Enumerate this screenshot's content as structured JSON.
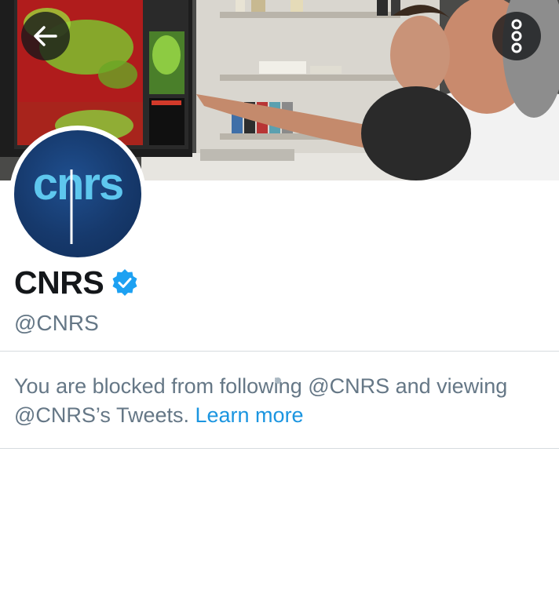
{
  "profile": {
    "name": "CNRS",
    "handle": "@CNRS",
    "verified": true,
    "avatar_logo_text": "cnrs"
  },
  "blocked_notice": {
    "text": "You are blocked from following @CNRS and viewing @CNRS’s Tweets.",
    "link_label": "Learn more"
  },
  "icons": {
    "back": "back-arrow-icon",
    "more": "more-options-icon",
    "verified": "verified-badge-icon"
  },
  "colors": {
    "name": "#14171a",
    "secondary_text": "#657786",
    "link": "#1b95e0",
    "verified_badge": "#1da1f2",
    "avatar_bg": "#16396c",
    "logo_light": "#5ec7ee"
  }
}
